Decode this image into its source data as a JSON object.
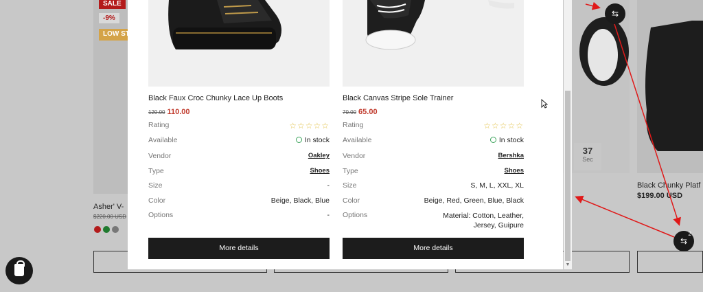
{
  "background": {
    "badges": [
      "SALE",
      "-9%",
      "LOW ST"
    ],
    "left_product_name": "Asher' V-",
    "left_product_price": "$220.00 USD",
    "timer_value": "37",
    "timer_unit": "Sec",
    "right_product_name": "Black Chunky Platf",
    "right_product_price": "$199.00 USD",
    "compare_count": "2",
    "swatch_colors": [
      "#b31b1b",
      "#1f7a2e",
      "#777777"
    ]
  },
  "compare": {
    "labels": {
      "rating": "Rating",
      "available": "Available",
      "vendor": "Vendor",
      "type": "Type",
      "size": "Size",
      "color": "Color",
      "options": "Options"
    },
    "products": [
      {
        "name": "Black Faux Croc Chunky Lace Up Boots",
        "old_price": "120.00",
        "price": "110.00",
        "stars": "☆☆☆☆☆",
        "available": "In stock",
        "vendor": "Oakley",
        "type": "Shoes",
        "size": "-",
        "color": "Beige, Black, Blue",
        "options": "-",
        "button": "More details"
      },
      {
        "name": "Black Canvas Stripe Sole Trainer",
        "old_price": "70.00",
        "price": "65.00",
        "stars": "☆☆☆☆☆",
        "available": "In stock",
        "vendor": "Bershka",
        "type": "Shoes",
        "size": "S, M, L, XXL, XL",
        "color": "Beige, Red, Green, Blue, Black",
        "options": "Material: Cotton, Leather, Jersey, Guipure",
        "button": "More details"
      }
    ]
  },
  "icons": {
    "compare": "compare-arrows-icon",
    "shop": "shopify-bag-icon",
    "star": "star-outline-icon",
    "stock": "check-circle-icon"
  },
  "colors": {
    "price_red": "#c0392b",
    "star_yellow": "#e2c24a",
    "stock_green": "#3aa35a",
    "button_dark": "#1c1c1c"
  }
}
